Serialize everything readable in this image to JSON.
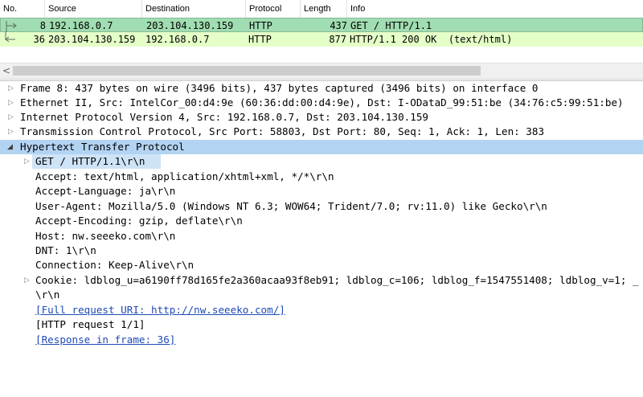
{
  "packet_list": {
    "columns": [
      "No.",
      "Source",
      "Destination",
      "Protocol",
      "Length",
      "Info"
    ],
    "rows": [
      {
        "no": "8",
        "source": "192.168.0.7",
        "destination": "203.104.130.159",
        "protocol": "HTTP",
        "length": "437",
        "info": "GET / HTTP/1.1",
        "color": "#a0ddb2"
      },
      {
        "no": "36",
        "source": "203.104.130.159",
        "destination": "192.168.0.7",
        "protocol": "HTTP",
        "length": "877",
        "info": "HTTP/1.1 200 OK  (text/html)",
        "color": "#e4ffc7"
      }
    ]
  },
  "scrollbar": {
    "left_arrow": "<"
  },
  "detail_tree": {
    "frame": "Frame 8: 437 bytes on wire (3496 bits), 437 bytes captured (3496 bits) on interface 0",
    "ethernet": "Ethernet II, Src: IntelCor_00:d4:9e (60:36:dd:00:d4:9e), Dst: I-ODataD_99:51:be (34:76:c5:99:51:be)",
    "ip": "Internet Protocol Version 4, Src: 192.168.0.7, Dst: 203.104.130.159",
    "tcp": "Transmission Control Protocol, Src Port: 58803, Dst Port: 80, Seq: 1, Ack: 1, Len: 383",
    "http": "Hypertext Transfer Protocol",
    "get": "GET / HTTP/1.1\\r\\n",
    "accept": "Accept: text/html, application/xhtml+xml, */*\\r\\n",
    "accept_language": "Accept-Language: ja\\r\\n",
    "user_agent": "User-Agent: Mozilla/5.0 (Windows NT 6.3; WOW64; Trident/7.0; rv:11.0) like Gecko\\r\\n",
    "accept_encoding": "Accept-Encoding: gzip, deflate\\r\\n",
    "host": "Host: nw.seeeko.com\\r\\n",
    "dnt": "DNT: 1\\r\\n",
    "connection": "Connection: Keep-Alive\\r\\n",
    "cookie": "Cookie: ldblog_u=a6190ff78d165fe2a360acaa93f8eb91; ldblog_c=106; ldblog_f=1547551408; ldblog_v=1; _",
    "crlf": "\\r\\n",
    "full_uri": "[Full request URI: http://nw.seeeko.com/]",
    "request_num": "[HTTP request 1/1]",
    "response_in": "[Response in frame: 36]"
  },
  "colors": {
    "selected_row": "#b3d3f3",
    "http_row_green": "#a0ddb2",
    "response_row_green": "#e4ffc7",
    "link": "#1f4bb5"
  },
  "icons": [
    "request-arrow-icon",
    "response-arrow-icon",
    "expand-triangle-icon",
    "collapse-triangle-icon"
  ]
}
